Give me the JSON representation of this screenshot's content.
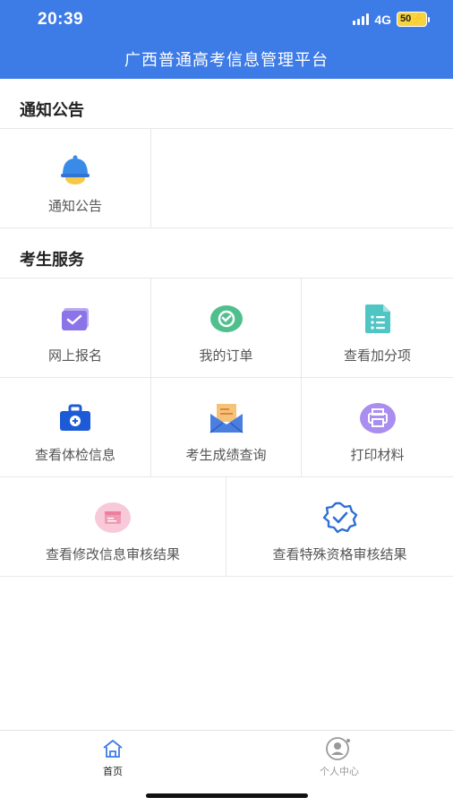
{
  "status_bar": {
    "time": "20:39",
    "network": "4G",
    "battery": "50"
  },
  "app": {
    "title": "广西普通高考信息管理平台"
  },
  "sections": {
    "notice": {
      "title": "通知公告",
      "items": [
        {
          "label": "通知公告",
          "icon": "bell-icon"
        }
      ]
    },
    "services": {
      "title": "考生服务",
      "items": [
        {
          "label": "网上报名",
          "icon": "registration-icon"
        },
        {
          "label": "我的订单",
          "icon": "order-icon"
        },
        {
          "label": "查看加分项",
          "icon": "bonus-list-icon"
        },
        {
          "label": "查看体检信息",
          "icon": "medical-kit-icon"
        },
        {
          "label": "考生成绩查询",
          "icon": "score-envelope-icon"
        },
        {
          "label": "打印材料",
          "icon": "printer-icon"
        },
        {
          "label": "查看修改信息审核结果",
          "icon": "modify-audit-icon"
        },
        {
          "label": "查看特殊资格审核结果",
          "icon": "verified-badge-icon"
        }
      ]
    }
  },
  "tabbar": {
    "tabs": [
      {
        "label": "首页",
        "icon": "home-icon",
        "active": true
      },
      {
        "label": "个人中心",
        "icon": "user-center-icon",
        "active": false
      }
    ]
  },
  "colors": {
    "primary": "#3d7be6",
    "active_tab": "#3d7be6",
    "inactive_tab": "#999999"
  }
}
